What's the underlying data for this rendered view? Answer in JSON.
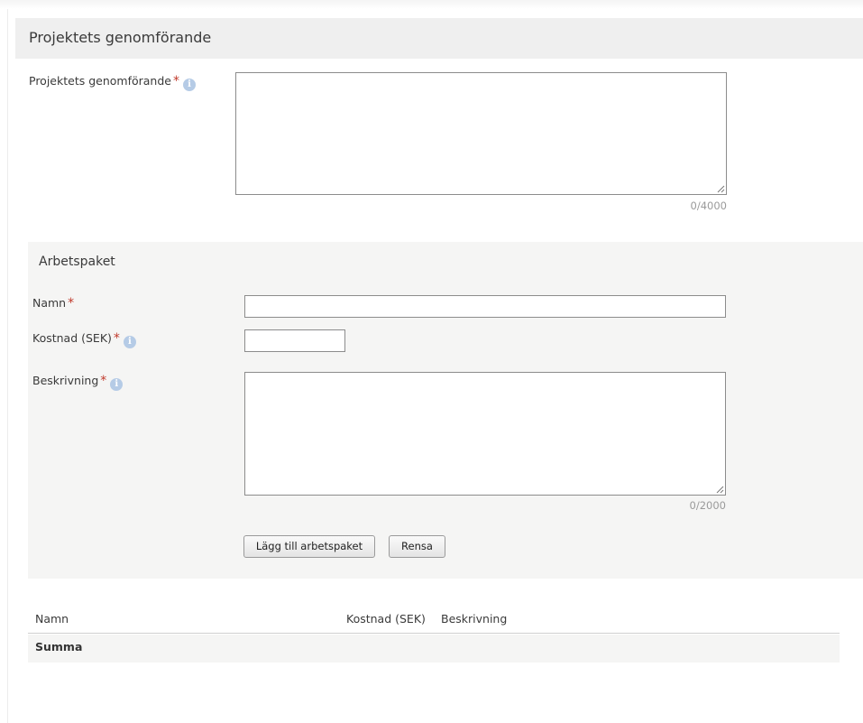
{
  "section": {
    "title": "Projektets genomförande"
  },
  "genomforande": {
    "label": "Projektets genomförande",
    "required": "*",
    "info_icon": "info-icon",
    "value": "",
    "counter": "0/4000"
  },
  "workpackage": {
    "title": "Arbetspaket",
    "name_label": "Namn",
    "cost_label": "Kostnad (SEK)",
    "desc_label": "Beskrivning",
    "required": "*",
    "name_value": "",
    "cost_value": "",
    "desc_value": "",
    "desc_counter": "0/2000",
    "add_button": "Lägg till arbetspaket",
    "clear_button": "Rensa"
  },
  "table": {
    "columns": [
      "Namn",
      "Kostnad (SEK)",
      "Beskrivning"
    ],
    "summary_label": "Summa"
  },
  "colors": {
    "required": "#c0392b",
    "info": "#b5cbe6",
    "header_bg": "#efefef",
    "panel_bg": "#f5f5f4"
  }
}
